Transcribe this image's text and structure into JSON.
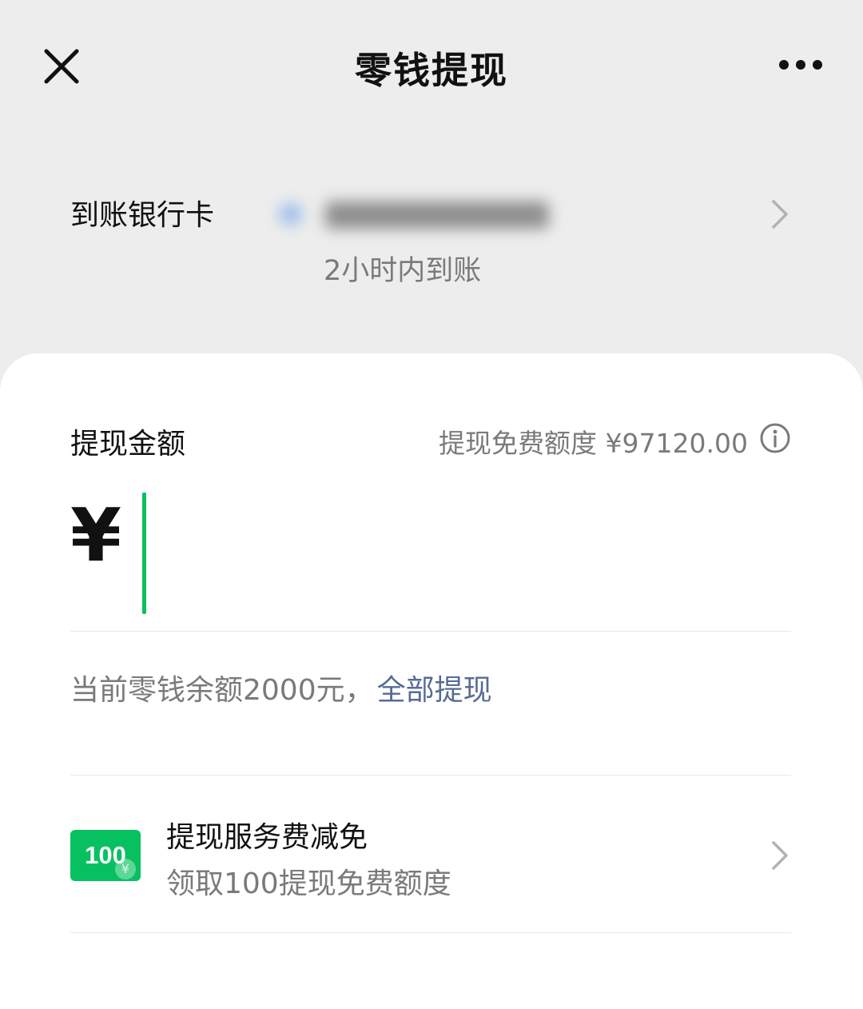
{
  "nav": {
    "title": "零钱提现",
    "close_icon": "close-icon",
    "more_icon": "more-icon"
  },
  "bank": {
    "label": "到账银行卡",
    "eta": "2小时内到账",
    "icon": "chevron-right-icon"
  },
  "amount": {
    "label": "提现金额",
    "quota_text": "提现免费额度 ¥97120.00",
    "info_icon": "info-icon",
    "currency": "¥",
    "value": "",
    "caret_color": "#07c160"
  },
  "balance": {
    "text": "当前零钱余额2000元，",
    "withdraw_all": "全部提现",
    "link_color": "#576b95"
  },
  "promo": {
    "badge": "100",
    "badge_color": "#07c160",
    "title": "提现服务费减免",
    "subtitle": "领取100提现免费额度"
  }
}
